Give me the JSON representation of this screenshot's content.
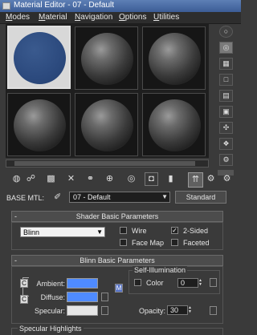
{
  "window": {
    "title": "Material Editor - 07 - Default"
  },
  "menubar": [
    {
      "mnemonic": "M",
      "rest": "odes"
    },
    {
      "mnemonic": "M",
      "rest": "aterial"
    },
    {
      "mnemonic": "N",
      "rest": "avigation"
    },
    {
      "mnemonic": "O",
      "rest": "ptions"
    },
    {
      "mnemonic": "U",
      "rest": "tilities"
    }
  ],
  "slots": {
    "active_index": 0,
    "count": 6,
    "active_color": "#2c4a7e"
  },
  "side_tools": [
    "sample-type-icon",
    "backlight-icon",
    "background-icon",
    "uv-tiling-icon",
    "video-color-check-icon",
    "make-preview-icon",
    "options-icon",
    "select-by-material-icon",
    "material-map-navigator-icon"
  ],
  "toolbar": [
    "get-material-icon",
    "put-to-scene-icon",
    "assign-to-selection-icon",
    "reset-map-icon",
    "make-unique-icon",
    "put-to-library-icon",
    "material-id-channel-icon",
    "show-map-in-viewport-icon",
    "show-end-result-icon",
    "go-to-parent-icon",
    "go-forward-to-sibling-icon"
  ],
  "base_mtl": {
    "label": "BASE MTL:",
    "name": "07 - Default",
    "type_button": "Standard"
  },
  "shader_basic": {
    "title": "Shader Basic Parameters",
    "shader": "Blinn",
    "options": [
      {
        "label": "Wire",
        "checked": false
      },
      {
        "label": "2-Sided",
        "checked": true,
        "mark": "✓"
      },
      {
        "label": "Face Map",
        "checked": false
      },
      {
        "label": "Faceted",
        "checked": false
      }
    ]
  },
  "blinn_basic": {
    "title": "Blinn Basic Parameters",
    "ambient_label": "Ambient:",
    "diffuse_label": "Diffuse:",
    "specular_label": "Specular:",
    "ambient_color": "#4f8bff",
    "diffuse_color": "#4f8bff",
    "specular_color": "#e6e6e6",
    "self_illum_title": "Self-Illumination",
    "color_label": "Color",
    "self_illum_value": "0",
    "opacity_label": "Opacity:",
    "opacity_value": "30",
    "lock_mark": "C",
    "map_lock_mark": "M"
  },
  "specular_highlights": {
    "title": "Specular Highlights"
  }
}
